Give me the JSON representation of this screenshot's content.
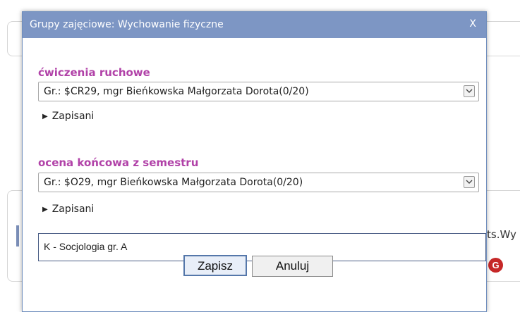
{
  "background": {
    "partial_text": "ts.Wy",
    "badge_letter": "G"
  },
  "dialog": {
    "title": "Grupy zajęciowe: Wychowanie fizyczne",
    "close_label": "X",
    "sections": [
      {
        "label": "ćwiczenia ruchowe",
        "selected": "Gr.: $CR29, mgr Bieńkowska Małgorzata Dorota(0/20)",
        "disclosure": "Zapisani"
      },
      {
        "label": "ocena końcowa z semestru",
        "selected": "Gr.: $O29, mgr Bieńkowska Małgorzata Dorota(0/20)",
        "disclosure": "Zapisani"
      }
    ],
    "group_text": "K - Socjologia gr. A",
    "save_label": "Zapisz",
    "cancel_label": "Anuluj"
  }
}
